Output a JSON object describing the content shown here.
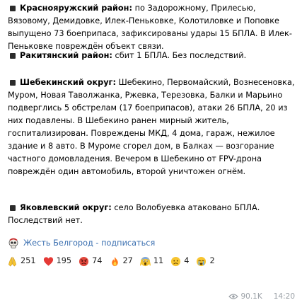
{
  "paragraphs": [
    {
      "title": "Краснояружский район:",
      "text": " по Задорожному, Прилесью, Вязовому, Демидовке, Илек-Пеньковке, Колотиловке и Поповке выпущено 73 боеприпаса, зафиксированы удары 15 БПЛА. В Илек-Пеньковке повреждён объект связи."
    },
    {
      "title": "Ракитянский район:",
      "text": " сбит 1 БПЛА. Без последствий."
    },
    {
      "title": "Шебекинский округ:",
      "text": " Шебекино, Первомайский, Вознесеновка, Муром, Новая Таволжанка, Ржевка, Терезовка, Балки и Марьино подверглись 5 обстрелам (17 боеприпасов), атаки 26 БПЛА, 20 из них подавлены. В Шебекино ранен мирный житель, госпитализирован. Повреждены МКД, 4 дома, гараж, нежилое здание и 8 авто. В Муроме сгорел дом, в Балках — возгорание частного домовладения. Вечером в Шебекино от FPV-дрона повреждён один автомобиль, второй уничтожен огнём."
    },
    {
      "title": "Яковлевский округ:",
      "text": " село Волобуевка атаковано БПЛА. Последствий нет."
    }
  ],
  "signature": {
    "icon": "skull-icon",
    "link_text": "Жесть Белгород - подписаться"
  },
  "reactions": [
    {
      "emoji": "folded-hands",
      "count": "251"
    },
    {
      "emoji": "red-heart",
      "count": "195"
    },
    {
      "emoji": "angry-face",
      "count": "74"
    },
    {
      "emoji": "fire",
      "count": "27"
    },
    {
      "emoji": "screaming-face",
      "count": "11"
    },
    {
      "emoji": "sad-face",
      "count": "4"
    },
    {
      "emoji": "crying-face",
      "count": "2"
    }
  ],
  "meta": {
    "views": "90.1K",
    "time": "14:20"
  },
  "colors": {
    "link": "#3a6fb0",
    "meta": "#9aa0a6",
    "heart": "#e53935",
    "fire": "#ff7a1a",
    "emoji_yellow": "#f7c531",
    "angry_red": "#e2483d"
  }
}
